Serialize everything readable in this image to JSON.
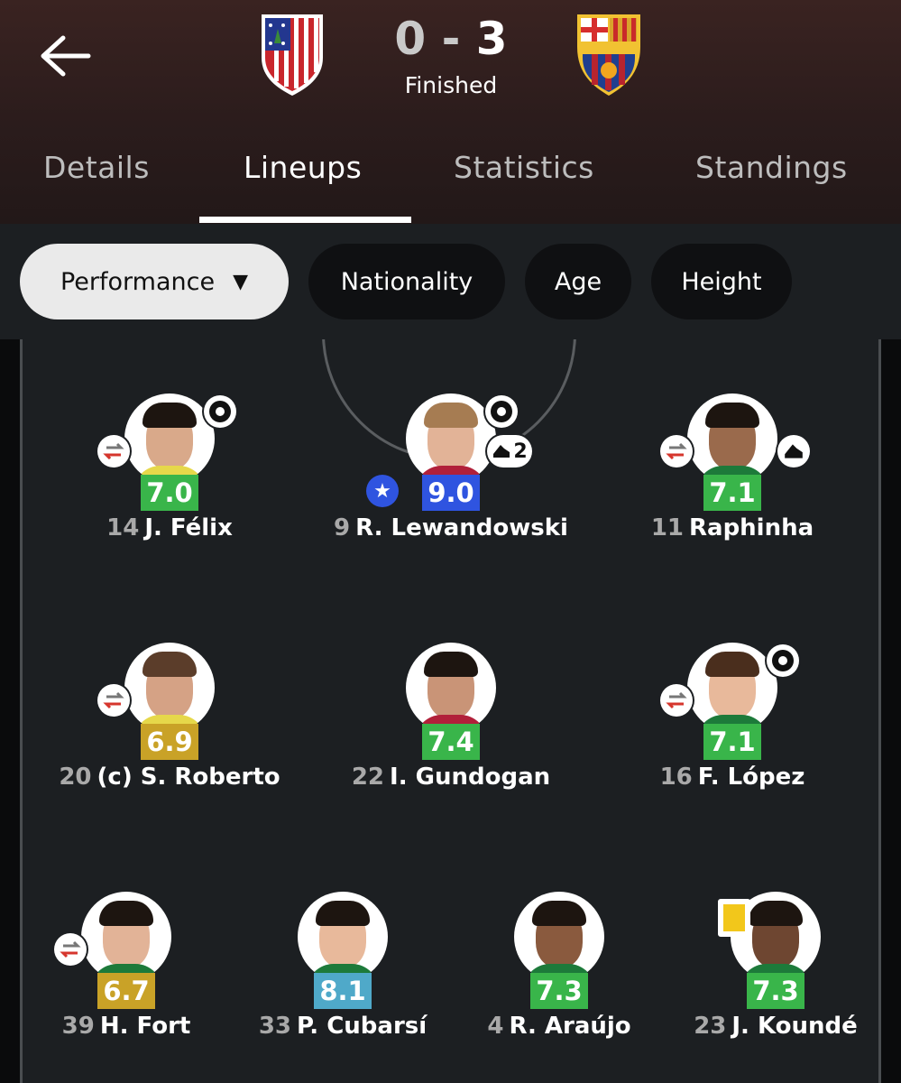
{
  "header": {
    "home_team": "Atlético de Madrid",
    "away_team": "FC Barcelona",
    "home_score": "0",
    "separator": "-",
    "away_score": "3",
    "status": "Finished"
  },
  "tabs": [
    {
      "label": "Details"
    },
    {
      "label": "Lineups",
      "active": true
    },
    {
      "label": "Statistics"
    },
    {
      "label": "Standings"
    }
  ],
  "filters": [
    {
      "label": "Performance",
      "selected": true,
      "caret": "▼"
    },
    {
      "label": "Nationality"
    },
    {
      "label": "Age"
    },
    {
      "label": "Height"
    }
  ],
  "colors": {
    "rating_green": "#39b54a",
    "rating_blue": "#2f54e0",
    "rating_yellow": "#c9a227",
    "rating_teal": "#4fa9c9",
    "yellow_card": "#f2c71b",
    "substitution_red": "#d6362d"
  },
  "players": [
    {
      "number": "14",
      "name": "J. Félix",
      "rating": "7.0",
      "rating_color": "#39b54a",
      "icons": [
        "goal-icon",
        "substitution-icon"
      ]
    },
    {
      "number": "9",
      "name": "R. Lewandowski",
      "rating": "9.0",
      "rating_color": "#2f54e0",
      "icons": [
        "goal-icon",
        "assist-boot-icon",
        "star-icon"
      ],
      "assist_count": "2",
      "star": "★"
    },
    {
      "number": "11",
      "name": "Raphinha",
      "rating": "7.1",
      "rating_color": "#39b54a",
      "icons": [
        "substitution-icon",
        "assist-boot-icon"
      ]
    },
    {
      "number": "20",
      "name": "(c) S. Roberto",
      "rating": "6.9",
      "rating_color": "#c9a227",
      "icons": [
        "substitution-icon"
      ]
    },
    {
      "number": "22",
      "name": "I. Gundogan",
      "rating": "7.4",
      "rating_color": "#39b54a",
      "icons": []
    },
    {
      "number": "16",
      "name": "F. López",
      "rating": "7.1",
      "rating_color": "#39b54a",
      "icons": [
        "goal-icon",
        "substitution-icon"
      ]
    },
    {
      "number": "39",
      "name": "H. Fort",
      "rating": "6.7",
      "rating_color": "#c9a227",
      "icons": [
        "substitution-icon"
      ]
    },
    {
      "number": "33",
      "name": "P. Cubarsí",
      "rating": "8.1",
      "rating_color": "#4fa9c9",
      "icons": []
    },
    {
      "number": "4",
      "name": "R. Araújo",
      "rating": "7.3",
      "rating_color": "#39b54a",
      "icons": []
    },
    {
      "number": "23",
      "name": "J. Koundé",
      "rating": "7.3",
      "rating_color": "#39b54a",
      "icons": [
        "yellow-card-icon"
      ]
    }
  ]
}
